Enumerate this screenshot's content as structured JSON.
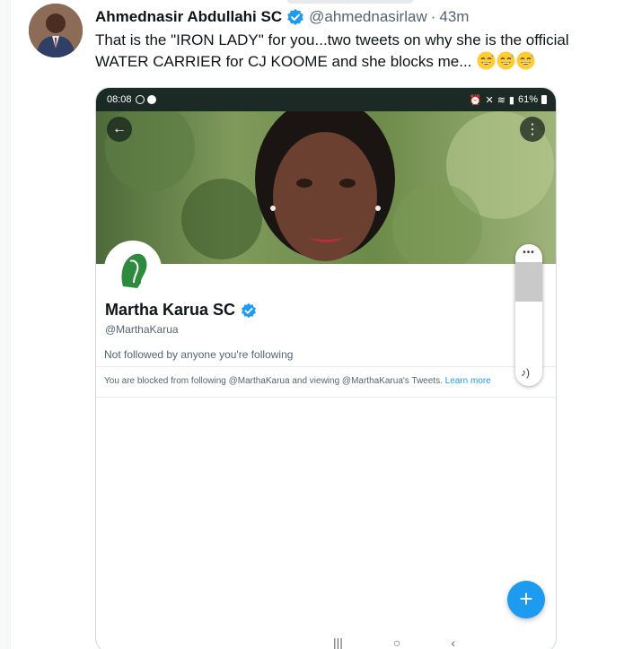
{
  "tweet": {
    "author_name": "Ahmednasir Abdullahi SC",
    "handle": "@ahmednasirlaw",
    "separator": "·",
    "time": "43m",
    "text_line1": "That is the \"IRON LADY\" for you...two tweets on why she is the official",
    "text_line2": "WATER CARRIER for CJ KOOME and she blocks me...",
    "emojis": [
      "grinning-sweat-emoji",
      "grinning-sweat-emoji",
      "grinning-sweat-emoji"
    ]
  },
  "screenshot": {
    "status_bar": {
      "time": "08:08",
      "battery": "61%"
    },
    "profile": {
      "name": "Martha Karua SC",
      "handle": "@MarthaKarua",
      "followed_by": "Not followed by anyone you're following",
      "blocked_notice": "You are blocked from following @MarthaKarua and viewing @MarthaKarua's Tweets.",
      "learn_more": "Learn more"
    },
    "fab_label": "+",
    "nav": {
      "recent": "|||",
      "home": "○",
      "back": "‹"
    }
  },
  "colors": {
    "accent": "#1d9bf0",
    "text": "#0f1419",
    "secondary": "#536471",
    "status_bar": "#1b2a24"
  }
}
